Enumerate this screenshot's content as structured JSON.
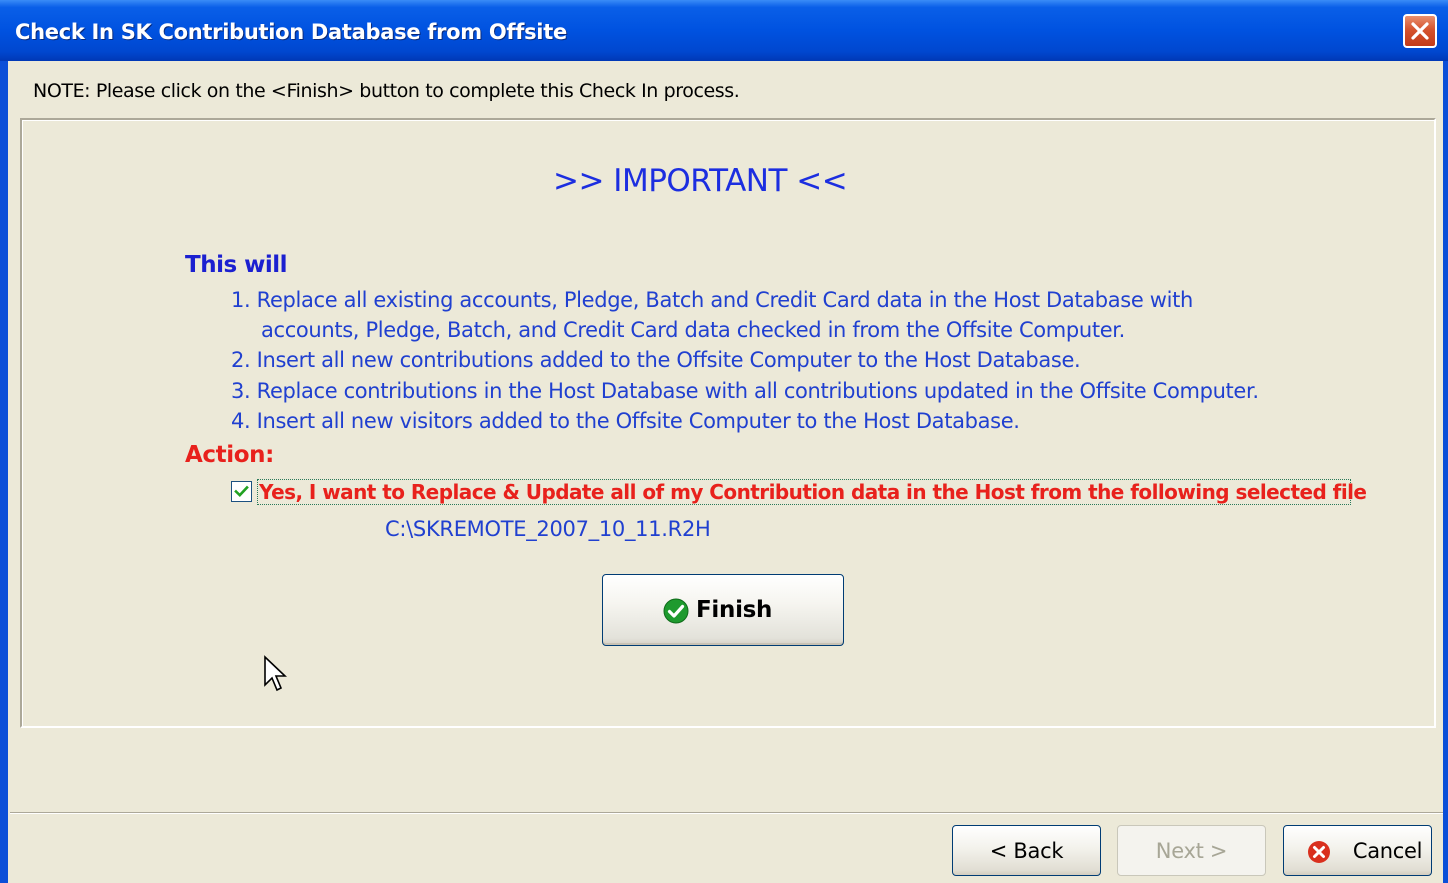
{
  "window": {
    "title": "Check In SK Contribution Database from Offsite"
  },
  "note": "NOTE:  Please click on the <Finish> button to complete this Check In process.",
  "content": {
    "heading": ">>  IMPORTANT  <<",
    "intro": "This will",
    "steps": [
      "1. Replace all existing accounts, Pledge, Batch and Credit Card data in the Host Database with",
      "accounts, Pledge, Batch, and Credit Card data checked in from the Offsite Computer.",
      "2. Insert all new contributions added to the Offsite Computer to the Host Database.",
      "3. Replace contributions in the Host Database with all contributions updated in the Offsite Computer.",
      "4. Insert all new visitors added to the Offsite Computer to the Host Database."
    ],
    "action_label": "Action:",
    "confirm_checkbox": {
      "checked": true,
      "label": "Yes, I want to Replace & Update all of my Contribution data in the Host from the following selected file"
    },
    "file_path": "C:\\SKREMOTE_2007_10_11.R2H",
    "finish_button": "Finish"
  },
  "buttons": {
    "back": "< Back",
    "next": "Next >",
    "cancel": "Cancel"
  },
  "colors": {
    "titlebar": "#0052e0",
    "heading_blue": "#1c2ee0",
    "step_blue": "#2040d0",
    "warning_red": "#e8211c",
    "dialog_bg": "#ece9d8"
  }
}
